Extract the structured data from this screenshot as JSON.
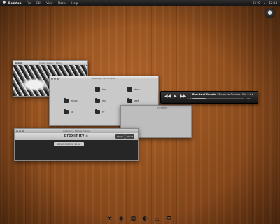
{
  "top_panel": {
    "app_name": "Desktop",
    "menus": [
      "File",
      "Edit",
      "View",
      "Places",
      "Help"
    ],
    "temperature": "63 °C",
    "clock": "12:34"
  },
  "image_window": {
    "title": "Image Viewer - 12ivy"
  },
  "folder_window": {
    "title": "Desktop - File Browser",
    "folders": [
      "bin",
      "docs",
      "music",
      "etc",
      "web",
      "lib",
      "tv",
      "src"
    ]
  },
  "media_player": {
    "track_title": "Boards of Canada",
    "track_detail": "- Tomorrow Pictures - Eta",
    "rating": "★★★",
    "elapsed": "0:26",
    "duration": "4:52",
    "progress": 0.25
  },
  "blank_window": {
    "title": "Desktop"
  },
  "browser_window": {
    "title": "proximity - Mozilla Firefox",
    "site_name": "proximity",
    "site_tagline": "●",
    "buttons": [
      "Home",
      "About"
    ],
    "date_pill": "DECEMBER 5, 2006"
  },
  "dock": {
    "icons": [
      "paw-icon",
      "firefox-icon",
      "terminal-icon",
      "palette-icon",
      "network-icon",
      "flash-icon"
    ]
  },
  "colors": {
    "desk_wood": "#93501e",
    "panel": "#1e1e1e"
  }
}
